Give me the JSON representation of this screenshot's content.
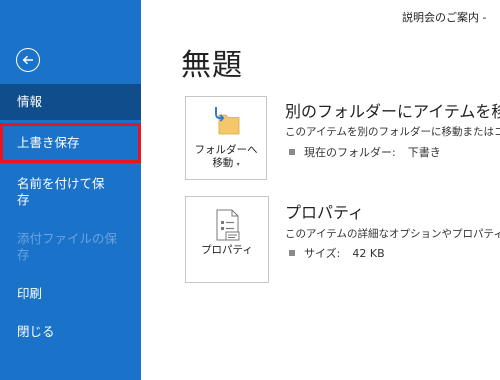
{
  "sidebar": {
    "items": [
      {
        "label": "情報",
        "state": "selected"
      },
      {
        "label": "上書き保存",
        "state": "highlight"
      },
      {
        "label_line1": "名前を付けて保",
        "label_line2": "存"
      },
      {
        "label_line1": "添付ファイルの保",
        "label_line2": "存",
        "state": "disabled"
      },
      {
        "label": "印刷"
      },
      {
        "label": "閉じる"
      }
    ]
  },
  "header": {
    "doc_caption": "説明会のご案内  -"
  },
  "main": {
    "title": "無題",
    "move": {
      "tile_line1": "フォルダーへ",
      "tile_line2": "移動",
      "heading": "別のフォルダーにアイテムを移",
      "description": "このアイテムを別のフォルダーに移動またはコピー",
      "meta_label": "現在のフォルダー:",
      "meta_value": "下書き"
    },
    "properties": {
      "tile_label": "プロパティ",
      "heading": "プロパティ",
      "description": "このアイテムの詳細なオプションやプロパティを設",
      "meta_label": "サイズ:",
      "meta_value": "42 KB"
    }
  },
  "colors": {
    "sidebar_bg": "#1a73c9",
    "selected_bg": "#0f4d8c",
    "highlight_border": "#e8141e"
  }
}
